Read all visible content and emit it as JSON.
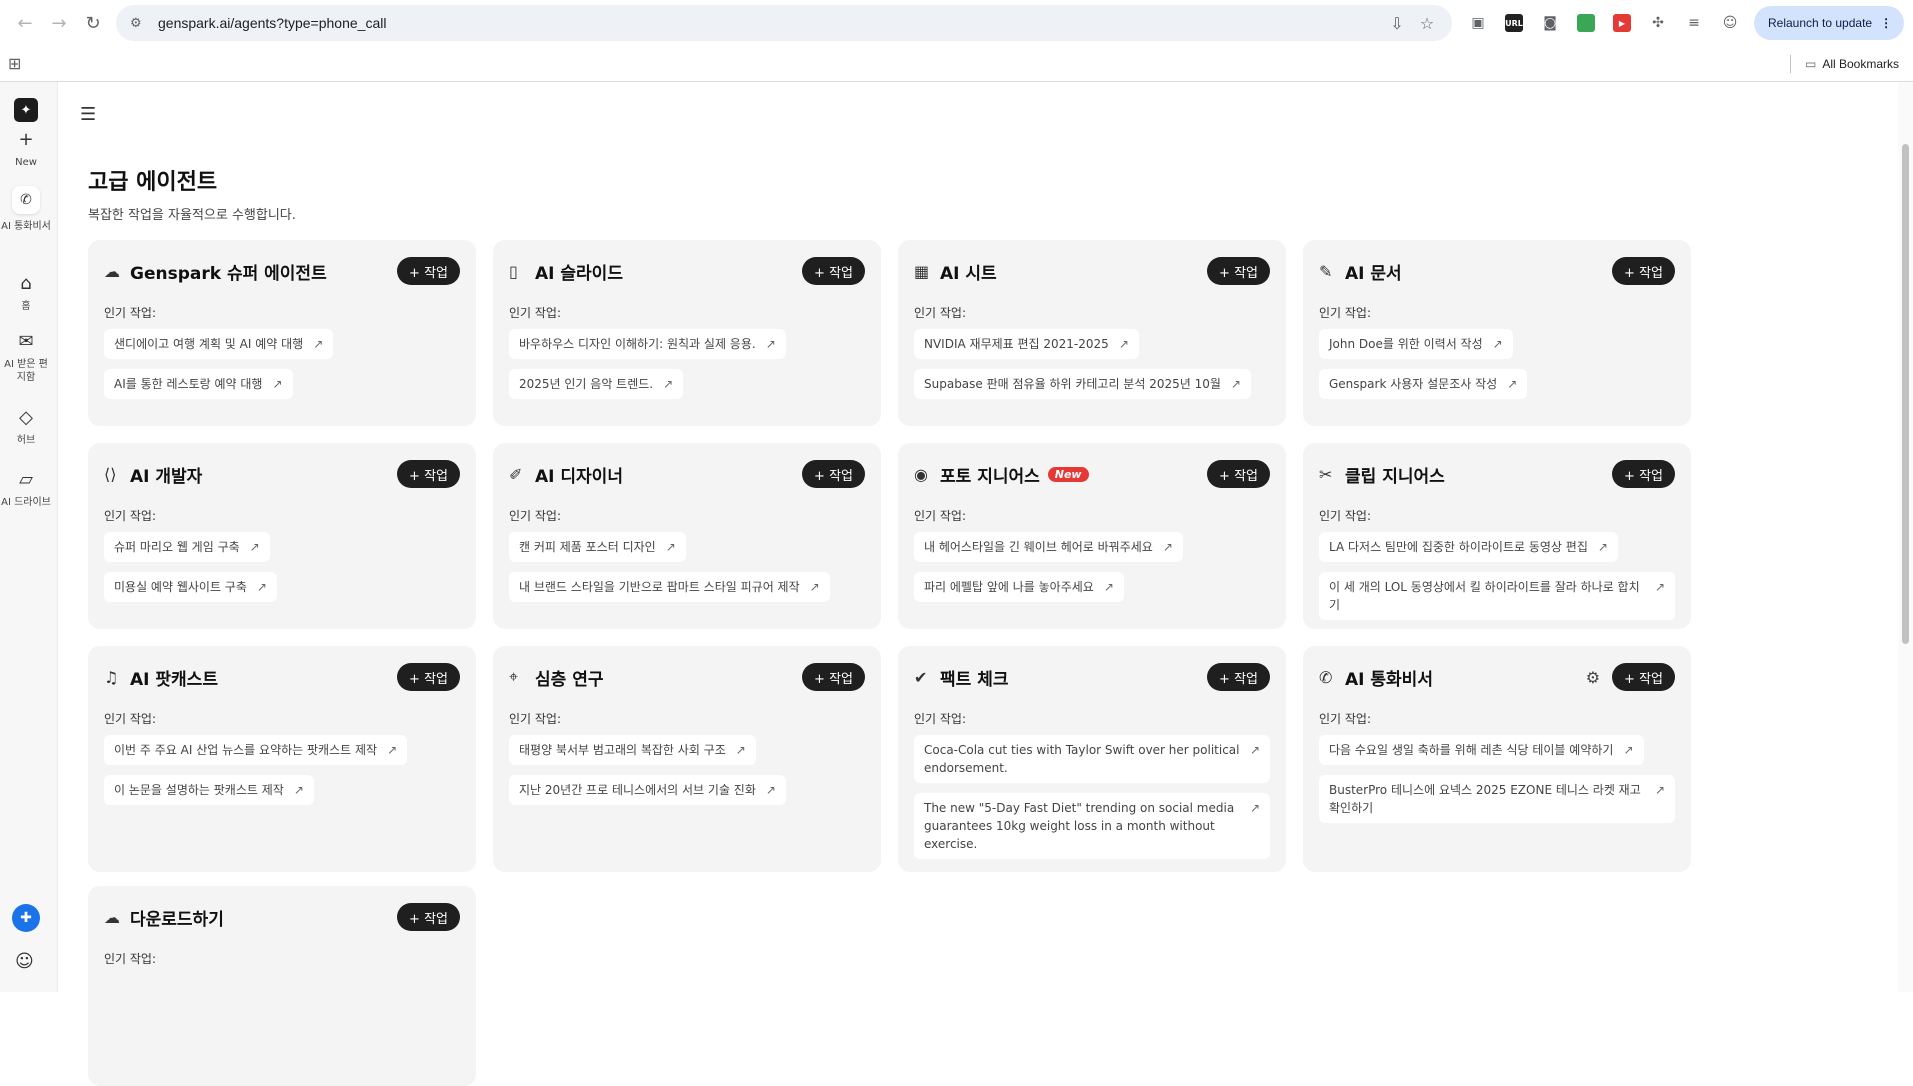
{
  "browser": {
    "url": "genspark.ai/agents?type=phone_call",
    "relaunch_label": "Relaunch to update",
    "all_bookmarks": "All Bookmarks",
    "ext_url_badge": "URL"
  },
  "sidebar": {
    "items": [
      {
        "label": "New",
        "icon": "plus-icon"
      },
      {
        "label": "AI 통화비서",
        "icon": "phone-call-icon"
      },
      {
        "label": "홈",
        "icon": "home-icon"
      },
      {
        "label": "AI 받은 편지함",
        "icon": "inbox-icon"
      },
      {
        "label": "허브",
        "icon": "hub-icon"
      },
      {
        "label": "AI 드라이브",
        "icon": "drive-icon"
      }
    ]
  },
  "page": {
    "title": "고급 에이전트",
    "subtitle": "복잡한 작업을 자율적으로 수행합니다."
  },
  "common": {
    "task_button": "+ 작업",
    "popular_label": "인기 작업:",
    "new_badge": "New"
  },
  "agents": [
    {
      "title": "Genspark 슈퍼 에이전트",
      "icon": "cloud-chat-icon",
      "tasks": [
        "샌디에이고 여행 계획 및 AI 예약 대행",
        "AI를 통한 레스토랑 예약 대행"
      ]
    },
    {
      "title": "AI 슬라이드",
      "icon": "slides-icon",
      "tasks": [
        "바우하우스 디자인 이해하기: 원칙과 실제 응용.",
        "2025년 인기 음악 트렌드."
      ]
    },
    {
      "title": "AI 시트",
      "icon": "table-icon",
      "tasks": [
        "NVIDIA 재무제표 편집 2021-2025",
        "Supabase 판매 점유율 하위 카테고리 분석 2025년 10월"
      ]
    },
    {
      "title": "AI 문서",
      "icon": "document-icon",
      "tasks": [
        "John Doe를 위한 이력서 작성",
        "Genspark 사용자 설문조사 작성"
      ]
    },
    {
      "title": "AI 개발자",
      "icon": "code-icon",
      "tasks": [
        "슈퍼 마리오 웹 게임 구축",
        "미용실 예약 웹사이트 구축"
      ]
    },
    {
      "title": "AI 디자이너",
      "icon": "designer-icon",
      "tasks": [
        "캔 커피 제품 포스터 디자인",
        "내 브랜드 스타일을 기반으로 팝마트 스타일 피규어 제작"
      ]
    },
    {
      "title": "포토 지니어스",
      "icon": "photo-icon",
      "new": true,
      "tasks": [
        "내 헤어스타일을 긴 웨이브 헤어로 바꿔주세요",
        "파리 에펠탑 앞에 나를 놓아주세요"
      ]
    },
    {
      "title": "클립 지니어스",
      "icon": "clip-icon",
      "tasks": [
        "LA 다저스 팀만에 집중한 하이라이트로 동영상 편집",
        "이 세 개의 LOL 동영상에서 킬 하이라이트를 잘라 하나로 합치기"
      ]
    },
    {
      "title": "AI 팟캐스트",
      "icon": "podcast-icon",
      "tasks": [
        "이번 주 주요 AI 산업 뉴스를 요약하는 팟캐스트 제작",
        "이 논문을 설명하는 팟캐스트 제작"
      ]
    },
    {
      "title": "심층 연구",
      "icon": "telescope-icon",
      "tasks": [
        "태평양 북서부 범고래의 복잡한 사회 구조",
        "지난 20년간 프로 테니스에서의 서브 기술 진화"
      ]
    },
    {
      "title": "팩트 체크",
      "icon": "check-circle-icon",
      "tasks": [
        "Coca-Cola cut ties with Taylor Swift over her political endorsement.",
        "The new \"5-Day Fast Diet\" trending on social media guarantees 10kg weight loss in a month without exercise."
      ]
    },
    {
      "title": "AI 통화비서",
      "icon": "phone-call-icon",
      "gear": true,
      "tasks": [
        "다음 수요일 생일 축하를 위해 레촌 식당 테이블 예약하기",
        "BusterPro 테니스에 요넥스 2025 EZONE 테니스 라켓 재고 확인하기"
      ]
    },
    {
      "title": "다운로드하기",
      "icon": "cloud-download-icon",
      "tasks": []
    }
  ]
}
